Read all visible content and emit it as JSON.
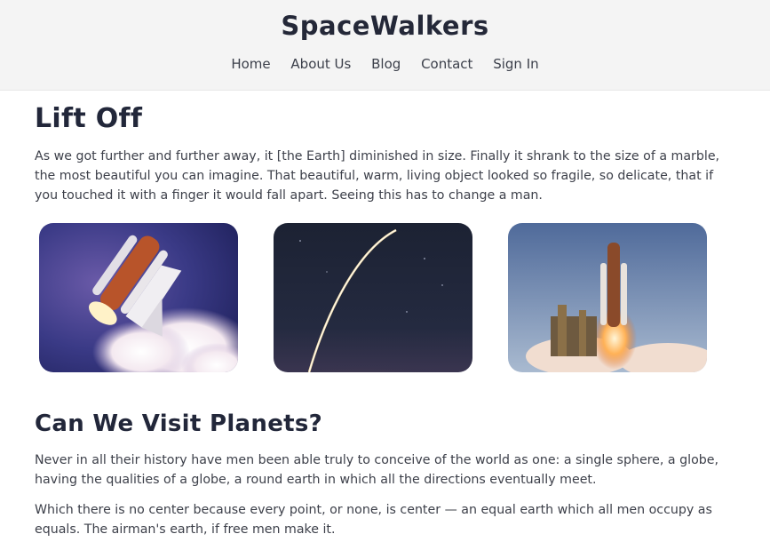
{
  "header": {
    "brand": "SpaceWalkers",
    "nav": [
      "Home",
      "About Us",
      "Blog",
      "Contact",
      "Sign In"
    ]
  },
  "sections": [
    {
      "title": "Lift Off",
      "paragraphs": [
        "As we got further and further away, it [the Earth] diminished in size. Finally it shrank to the size of a marble, the most beautiful you can imagine. That beautiful, warm, living object looked so fragile, so delicate, that if you touched it with a finger it would fall apart. Seeing this has to change a man."
      ],
      "images": [
        "space-shuttle-launch-photo",
        "rocket-trail-night-sky-photo",
        "rocket-on-launch-pad-photo"
      ]
    },
    {
      "title": "Can We Visit Planets?",
      "paragraphs": [
        "Never in all their history have men been able truly to conceive of the world as one: a single sphere, a globe, having the qualities of a globe, a round earth in which all the directions eventually meet.",
        "Which there is no center because every point, or none, is center — an equal earth which all men occupy as equals. The airman's earth, if free men make it."
      ]
    }
  ],
  "colors": {
    "header_bg": "#f4f4f4",
    "heading": "#22273a",
    "body_text": "#3d404a"
  }
}
